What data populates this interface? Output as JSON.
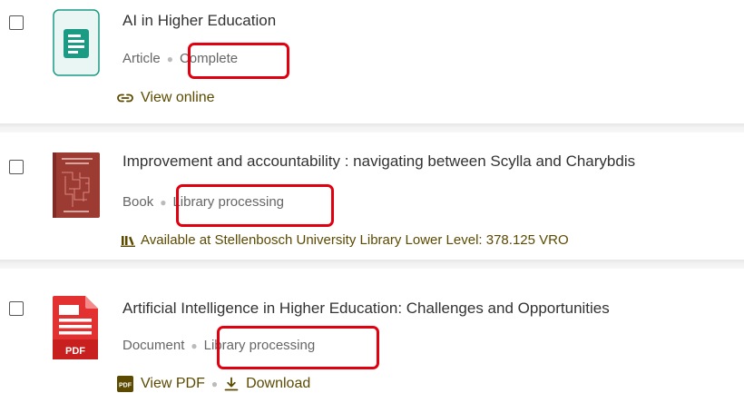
{
  "results": [
    {
      "title": "AI in Higher Education",
      "type": "Article",
      "status": "Complete",
      "links": [
        {
          "label": "View online",
          "icon": "link-icon"
        }
      ]
    },
    {
      "title": "Improvement and accountability : navigating between Scylla and Charybdis",
      "type": "Book",
      "status": "Library processing",
      "availability": "Available at Stellenbosch University Library Lower Level: 378.125 VRO",
      "availability_icon": "library-books-icon"
    },
    {
      "title": "Artificial Intelligence in Higher Education: Challenges and Opportunities",
      "type": "Document",
      "status": "Library processing",
      "thumb_label": "PDF",
      "links": [
        {
          "label": "View PDF",
          "icon": "pdf-icon",
          "icon_text": "PDF"
        },
        {
          "label": "Download",
          "icon": "download-icon"
        }
      ]
    }
  ],
  "colors": {
    "highlight": "#e0000f",
    "link": "#5c4a00",
    "article_icon": "#1b9a84",
    "pdf_red": "#e33131",
    "book_cover": "#9c3b32"
  }
}
